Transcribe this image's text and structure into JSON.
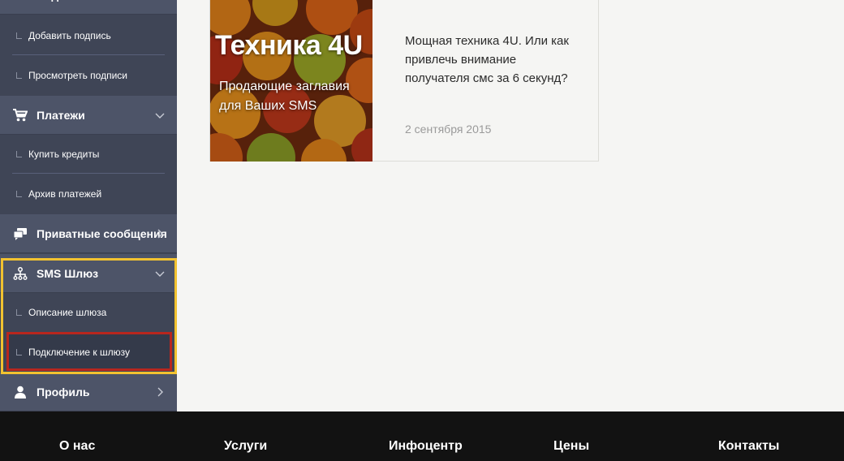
{
  "sidebar": {
    "podpisi_label": "Подписи",
    "add_signature": "Добавить подпись",
    "view_signatures": "Просмотреть подписи",
    "payments_label": "Платежи",
    "buy_credits": "Купить кредиты",
    "payments_archive": "Архив платежей",
    "private_messages": "Приватные сообщения",
    "sms_gateway": "SMS Шлюз",
    "gateway_description": "Описание шлюза",
    "gateway_connection": "Подключение к шлюзу",
    "profile": "Профиль"
  },
  "article": {
    "image_title": "Техника 4U",
    "image_subtitle": "Продающие заглавия для Ваших SMS",
    "title": "Мощная техника 4U. Или как привлечь внимание получателя смс за 6 секунд?",
    "date": "2 сентября 2015"
  },
  "footer": {
    "about": "О нас",
    "services": "Услуги",
    "infocenter": "Инфоцентр",
    "prices": "Цены",
    "contacts": "Контакты"
  },
  "colors": {
    "sidebar_bg": "#3f4556",
    "section_bg": "#4d5468",
    "highlight_yellow": "#f2c230",
    "highlight_red": "#b8261e",
    "footer_bg": "#121212"
  }
}
